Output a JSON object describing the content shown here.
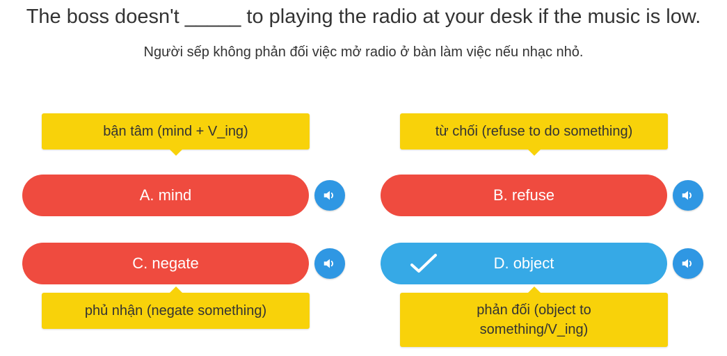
{
  "question": {
    "text": "The boss doesn't _____ to playing the radio at your desk if the music is low.",
    "translation": "Người sếp không phản đối việc mở radio ở bàn làm việc nếu nhạc nhỏ."
  },
  "options": [
    {
      "id": "A",
      "label": "A. mind",
      "hint": "bận tâm (mind + V_ing)",
      "state": "wrong",
      "color": "#ef4b3f"
    },
    {
      "id": "B",
      "label": "B. refuse",
      "hint": "từ chối (refuse to do something)",
      "state": "wrong",
      "color": "#ef4b3f"
    },
    {
      "id": "C",
      "label": "C. negate",
      "hint": "phủ nhận (negate something)",
      "state": "wrong",
      "color": "#ef4b3f"
    },
    {
      "id": "D",
      "label": "D. object",
      "hint_line1": "phản đối (object to",
      "hint_line2": "something/V_ing)",
      "state": "correct",
      "color": "#36a9e6"
    }
  ],
  "icons": {
    "audio": "speaker-icon",
    "check": "checkmark-icon"
  },
  "colors": {
    "hint_bg": "#f8d20a",
    "audio_bg": "#2f97e3"
  }
}
